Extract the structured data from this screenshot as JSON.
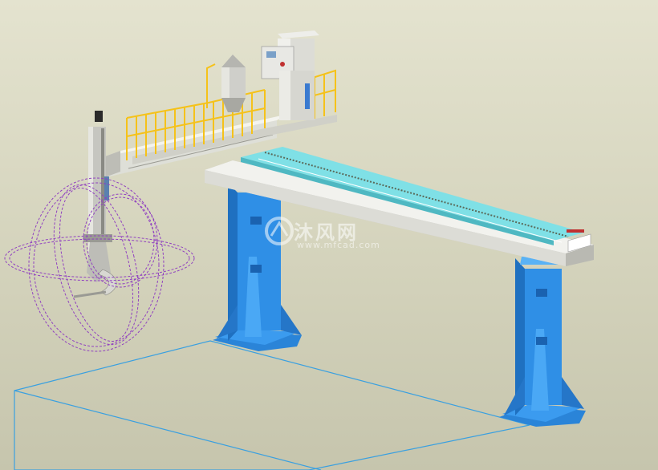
{
  "watermark": {
    "brand": "沐风网",
    "url": "www.mfcad.com"
  },
  "colors": {
    "background_top": "#e4e3cf",
    "background_bottom": "#c6c5ad",
    "column": "#2f8fe6",
    "rail": "#7fe0e6",
    "beam": "#f2f2ee",
    "guardrail": "#f5c21a",
    "sketch_line": "#9040c0",
    "floor_line": "#3aa0e0"
  },
  "parts": [
    "floor-outline",
    "rear-column",
    "front-column",
    "main-beam",
    "linear-rail",
    "cross-arm",
    "platform",
    "guardrail",
    "cone-hopper",
    "control-cabinet",
    "vertical-mast",
    "tool-head",
    "work-envelope"
  ]
}
